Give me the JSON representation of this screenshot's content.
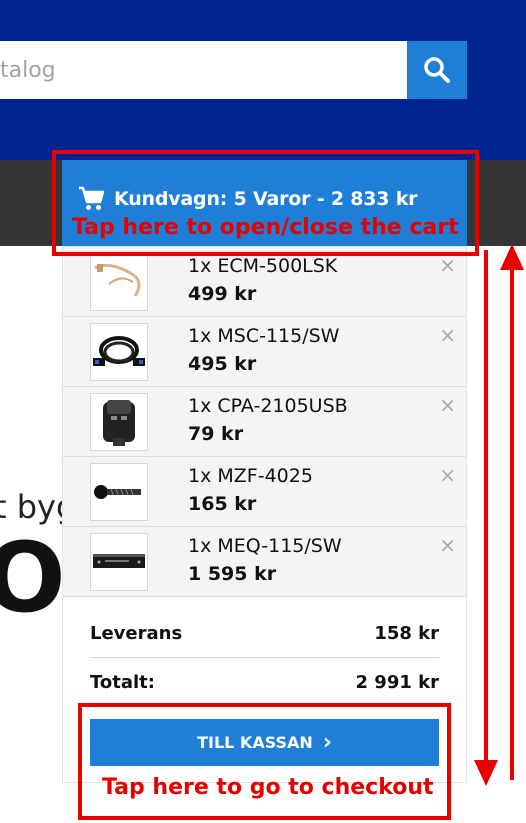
{
  "header": {
    "search_placeholder": "talog",
    "search_icon": "search-icon"
  },
  "background": {
    "fragment_small": "t byg",
    "fragment_big": "O"
  },
  "cart": {
    "title": "Kundvagn: 5 Varor - 2 833 kr",
    "cart_icon": "shopping-cart-icon",
    "items": [
      {
        "name": "1x ECM-500LSK",
        "price": "499 kr"
      },
      {
        "name": "1x MSC-115/SW",
        "price": "495 kr"
      },
      {
        "name": "1x CPA-2105USB",
        "price": "79 kr"
      },
      {
        "name": "1x MZF-4025",
        "price": "165 kr"
      },
      {
        "name": "1x MEQ-115/SW",
        "price": "1 595 kr"
      }
    ],
    "remove_symbol": "×",
    "shipping_label": "Leverans",
    "shipping_value": "158 kr",
    "total_label": "Totalt:",
    "total_value": "2 991 kr",
    "checkout_label": "TILL KASSAN",
    "checkout_chevron": "›"
  },
  "annotations": {
    "open_close": "Tap here to open/close the cart",
    "checkout": "Tap here to go to checkout",
    "color": "#e60000"
  },
  "colors": {
    "header_bg": "#002491",
    "accent": "#1f7fd6",
    "navbar_bg": "#353535"
  }
}
